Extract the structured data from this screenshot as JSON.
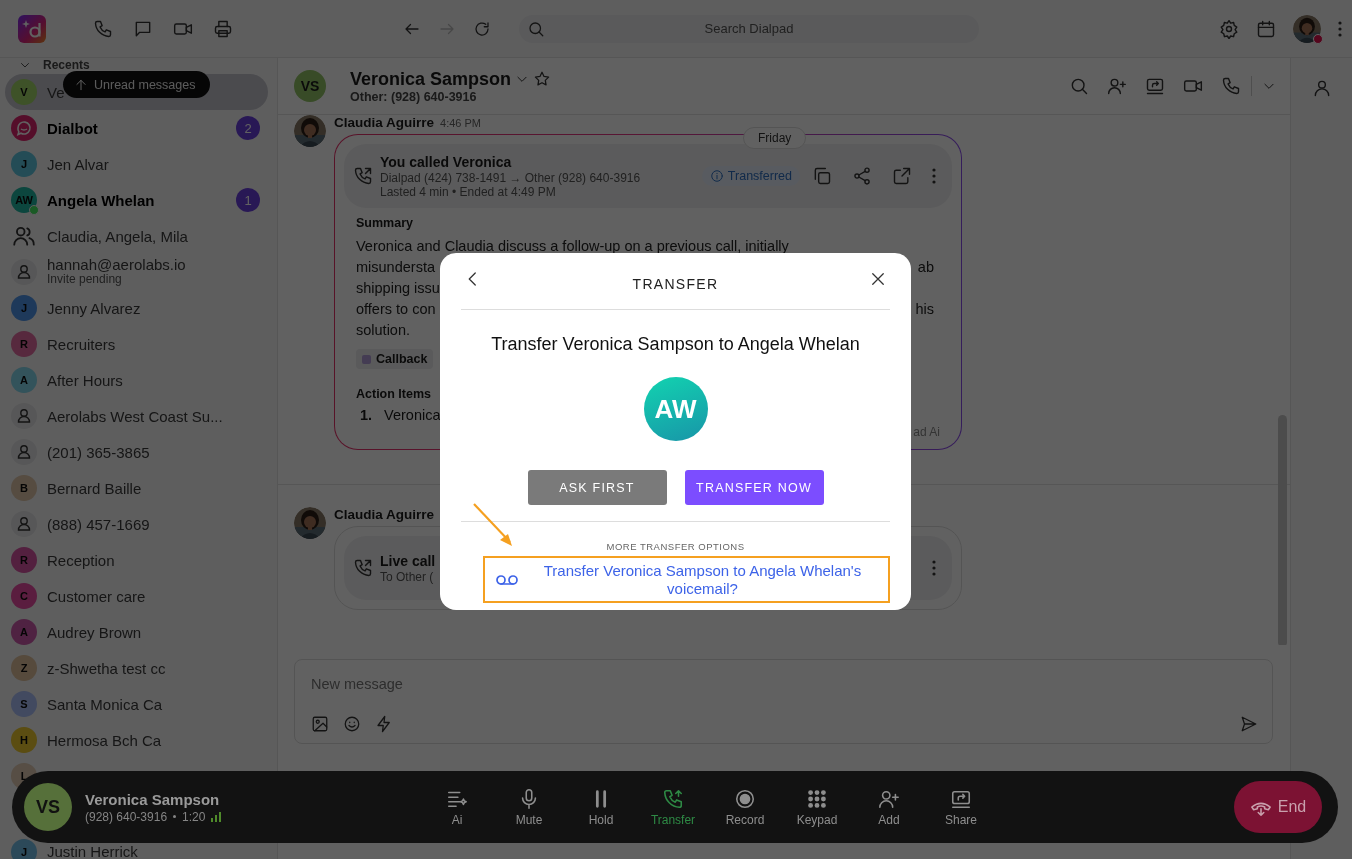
{
  "app_bar": {
    "search": {
      "placeholder": "Search Dialpad"
    }
  },
  "sidebar": {
    "section": "Recents",
    "expanded": true,
    "tooltip": "Unread messages",
    "items": [
      {
        "kind": "letter",
        "initials": "V",
        "color": "#3e5228",
        "name": "Ve",
        "unread": false,
        "selected": true,
        "online": false
      },
      {
        "kind": "bot",
        "name": "Dialbot",
        "unread": true,
        "badge": "2",
        "selected": false,
        "online": false
      },
      {
        "kind": "letter",
        "initials": "J",
        "color": "#244c56",
        "name": "Jen Alvar",
        "unread": false,
        "selected": false,
        "online": false
      },
      {
        "kind": "letter",
        "initials": "AW",
        "color": "#0c463e",
        "name": "Angela Whelan",
        "unread": true,
        "badge": "1",
        "selected": false,
        "online": true
      },
      {
        "kind": "group",
        "name": "Claudia, Angela, Mila",
        "unread": false,
        "selected": false,
        "online": false
      },
      {
        "kind": "person",
        "name": "hannah@aerolabs.io",
        "subtitle": "Invite pending",
        "unread": false,
        "selected": false,
        "online": false
      },
      {
        "kind": "letter",
        "initials": "J",
        "color": "#1e395a",
        "name": "Jenny Alvarez",
        "unread": false,
        "selected": false,
        "online": false
      },
      {
        "kind": "letter",
        "initials": "R",
        "color": "#57293e",
        "name": "Recruiters",
        "unread": false,
        "selected": false,
        "online": false
      },
      {
        "kind": "letter",
        "initials": "A",
        "color": "#33535b",
        "name": "After Hours",
        "unread": false,
        "selected": false,
        "online": false
      },
      {
        "kind": "person",
        "name": "Aerolabs West Coast Su...",
        "unread": false,
        "selected": false,
        "online": false
      },
      {
        "kind": "person",
        "name": "(201) 365-3865",
        "unread": false,
        "selected": false,
        "online": false
      },
      {
        "kind": "letter",
        "initials": "B",
        "color": "#564c41",
        "name": "Bernard Baille",
        "unread": false,
        "selected": false,
        "online": false
      },
      {
        "kind": "person",
        "name": "(888) 457-1669",
        "unread": false,
        "selected": false,
        "online": false
      },
      {
        "kind": "letter",
        "initials": "R",
        "color": "#53203f",
        "name": "Reception",
        "unread": false,
        "selected": false,
        "online": false
      },
      {
        "kind": "letter",
        "initials": "C",
        "color": "#5a1d3f",
        "name": "Customer care",
        "unread": false,
        "selected": false,
        "online": false
      },
      {
        "kind": "letter",
        "initials": "A",
        "color": "#4f2242",
        "name": "Audrey Brown",
        "unread": false,
        "selected": false,
        "online": false
      },
      {
        "kind": "letter",
        "initials": "Z",
        "color": "#564a3c",
        "name": "z-Shwetha test cc",
        "unread": false,
        "selected": false,
        "online": false
      },
      {
        "kind": "letter",
        "initials": "S",
        "color": "#424a60",
        "name": "Santa Monica Ca",
        "unread": false,
        "selected": false,
        "online": false
      },
      {
        "kind": "letter",
        "initials": "H",
        "color": "#5b4d12",
        "name": "Hermosa Bch Ca",
        "unread": false,
        "selected": false,
        "online": false
      },
      {
        "kind": "letter",
        "initials": "L",
        "color": "#574e45"
      },
      {
        "kind": "letter",
        "initials": "J",
        "color": "#2c4959",
        "name": "Justin Herrick",
        "unread": false,
        "selected": false
      }
    ]
  },
  "conversation": {
    "contact": {
      "initials": "VS",
      "name": "Veronica Sampson",
      "detail": "Other: (928) 640-3916",
      "starred": false
    },
    "messages": [
      {
        "author": "Claudia Aguirre",
        "time": "4:46 PM",
        "date_chip": "Friday",
        "call": {
          "title": "You called Veronica",
          "route": "Dialpad (424) 738-1491 → Other (928) 640-3916",
          "meta": "Lasted 4 min • Ended at 4:49 PM",
          "status": "Transferred"
        },
        "summary": {
          "heading": "Summary",
          "lines": [
            {
              "left": "Veronica and Claudia discuss a follow-up on a previous call, initially"
            },
            {
              "left": "misundersta",
              "right": "ab"
            },
            {
              "left": "shipping issu"
            },
            {
              "left": "offers to con",
              "right": "his"
            },
            {
              "left": "solution."
            }
          ],
          "tag": "Callback",
          "actions_heading": "Action Items",
          "actions": [
            {
              "number": "1.",
              "text": "Veronica"
            }
          ],
          "footer": "ad Ai"
        }
      },
      {
        "author": "Claudia Aguirre",
        "call": {
          "title": "Live call",
          "route": "To Other ("
        }
      }
    ]
  },
  "composer": {
    "placeholder": "New message"
  },
  "modal": {
    "title": "TRANSFER",
    "heading": "Transfer Veronica Sampson to Angela Whelan",
    "initials": "AW",
    "buttons": [
      {
        "label": "ASK FIRST",
        "kind": "secondary"
      },
      {
        "label": "TRANSFER NOW",
        "kind": "primary"
      }
    ],
    "options_heading": "MORE TRANSFER OPTIONS",
    "voicemail_link": "Transfer Veronica Sampson to Angela Whelan's voicemail?"
  },
  "call_bar": {
    "initials": "VS",
    "name": "Veronica Sampson",
    "number": "(928) 640-3916",
    "duration": "1:20",
    "actions": [
      {
        "label": "Ai",
        "selected": false
      },
      {
        "label": "Mute",
        "selected": false
      },
      {
        "label": "Hold",
        "selected": false
      },
      {
        "label": "Transfer",
        "selected": true
      },
      {
        "label": "Record",
        "selected": false
      },
      {
        "label": "Keypad",
        "selected": false
      },
      {
        "label": "Add",
        "selected": false
      },
      {
        "label": "Share",
        "selected": false
      }
    ],
    "end": "End"
  }
}
